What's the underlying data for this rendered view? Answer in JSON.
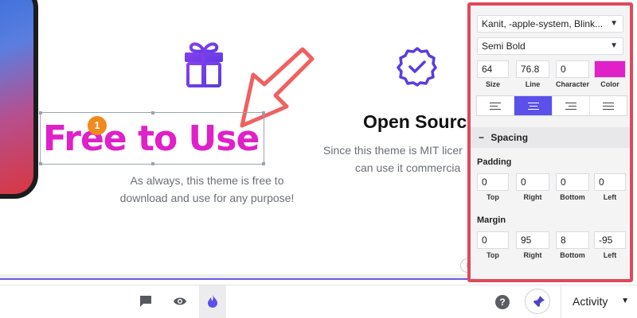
{
  "canvas": {
    "headline": "Free to Use",
    "step_marker": "1",
    "description": "As always, this theme is free to download and use for any purpose!",
    "second_feature": {
      "title": "Open Sourc",
      "desc_line1": "Since this theme is MIT licer",
      "desc_line2": "can use it commercia"
    },
    "icons": [
      "gift-icon",
      "verified-badge-icon"
    ],
    "accent_color": "#e020c8",
    "arrow_color": "#f06060"
  },
  "panel": {
    "font_family": "Kanit, -apple-system, Blink...",
    "font_weight": "Semi Bold",
    "size": {
      "value": "64",
      "label": "Size"
    },
    "line": {
      "value": "76.8",
      "label": "Line"
    },
    "character": {
      "value": "0",
      "label": "Character"
    },
    "color": {
      "value": "#e020c8",
      "label": "Color"
    },
    "alignment": {
      "options": [
        "left",
        "center",
        "right",
        "justify"
      ],
      "selected": "center"
    },
    "spacing_section": "Spacing",
    "padding": {
      "label": "Padding",
      "top": {
        "value": "0",
        "label": "Top"
      },
      "right": {
        "value": "0",
        "label": "Right"
      },
      "bottom": {
        "value": "0",
        "label": "Bottom"
      },
      "left": {
        "value": "0",
        "label": "Left"
      }
    },
    "margin": {
      "label": "Margin",
      "top": {
        "value": "0",
        "label": "Top"
      },
      "right": {
        "value": "95",
        "label": "Right"
      },
      "bottom": {
        "value": "8",
        "label": "Bottom"
      },
      "left": {
        "value": "-95",
        "label": "Left"
      }
    },
    "highlight_color": "#e0485a"
  },
  "toolbar": {
    "icons": [
      "comment-icon",
      "eye-icon",
      "flame-icon"
    ],
    "active_icon": "flame-icon",
    "help_label": "?",
    "pin_icon": "pin-icon",
    "activity_label": "Activity",
    "brand_color": "#5b50ea"
  }
}
